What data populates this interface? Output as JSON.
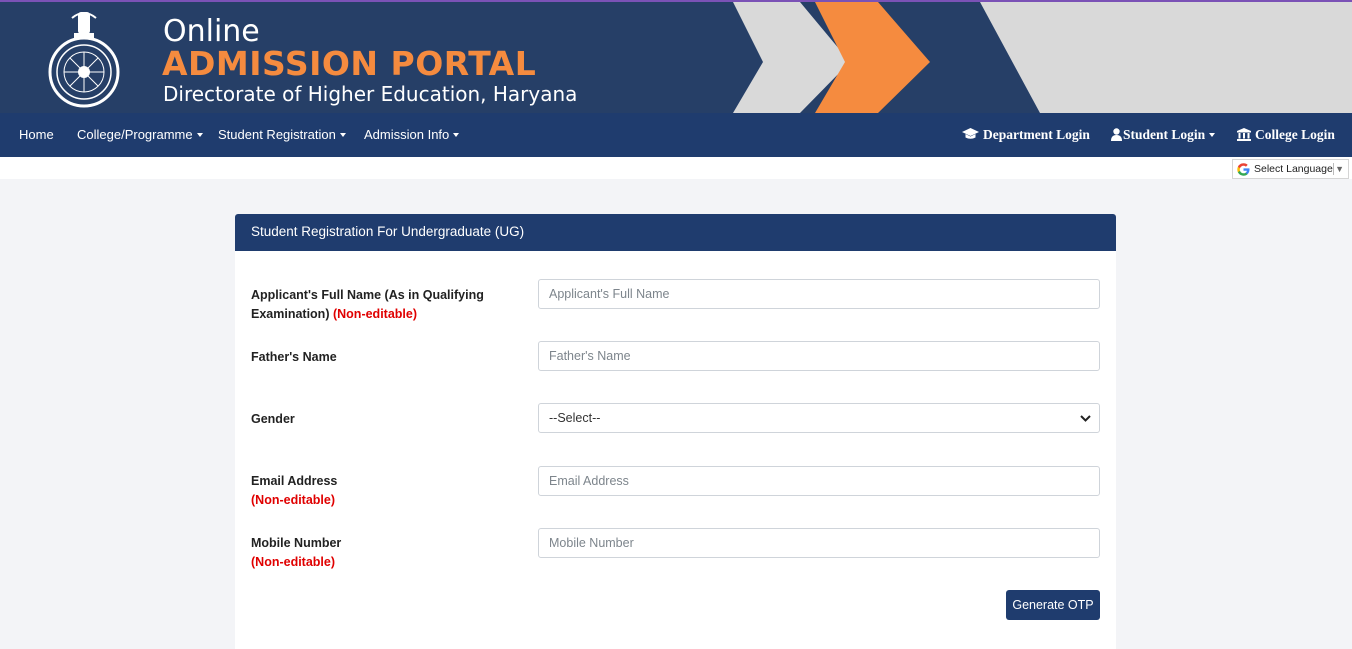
{
  "header": {
    "title_top": "Online",
    "title_main": "ADMISSION PORTAL",
    "subtitle": "Directorate of Higher Education, Haryana"
  },
  "nav": {
    "home": "Home",
    "college_programme": "College/Programme",
    "student_registration": "Student Registration",
    "admission_info": "Admission Info",
    "department_login": "Department Login",
    "student_login": "Student Login",
    "college_login": "College Login"
  },
  "language": {
    "label": "Select Language"
  },
  "form": {
    "title": "Student Registration For Undergraduate (UG)",
    "full_name_label": "Applicant's Full Name (As in Qualifying Examination)",
    "full_name_note": "(Non-editable)",
    "full_name_placeholder": "Applicant's Full Name",
    "father_label": "Father's Name",
    "father_placeholder": "Father's Name",
    "gender_label": "Gender",
    "gender_value": "--Select--",
    "email_label": "Email Address",
    "email_note": "(Non-editable)",
    "email_placeholder": "Email Address",
    "mobile_label": "Mobile Number",
    "mobile_note": "(Non-editable)",
    "mobile_placeholder": "Mobile Number",
    "submit_label": "Generate OTP"
  },
  "colors": {
    "navy": "#1f3c6e",
    "banner": "#263f67",
    "orange": "#f58b3f",
    "required_red": "#e00000"
  }
}
